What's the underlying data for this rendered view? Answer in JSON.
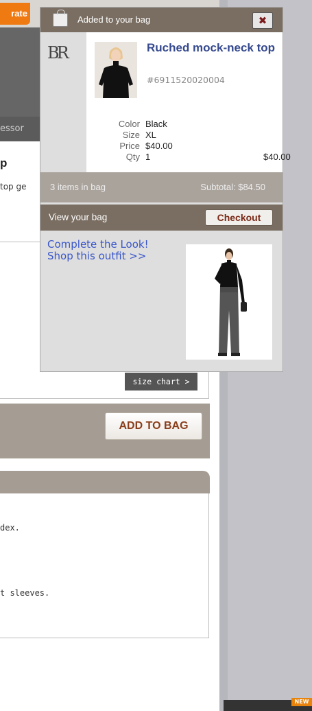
{
  "colors": {
    "accent_orange": "#f07a12",
    "popup_header": "#7a6e62",
    "link_blue": "#3a57c9",
    "product_name": "#35498e",
    "checkout_text": "#7a2a16"
  },
  "page": {
    "rate_button": "rate",
    "nav_label": "essor",
    "product_title_fragment": "p",
    "product_desc_fragment": "top ge",
    "size_chart_button": "size chart >",
    "add_to_bag_button": "ADD TO BAG",
    "details_lines": [
      "dex.",
      "t sleeves."
    ],
    "new_badge": "NEW"
  },
  "popup": {
    "bag_icon": "shopping-bag-icon",
    "title": "Added to your bag",
    "close_label": "✖",
    "logo_text": "BR",
    "item": {
      "name": "Ruched mock-neck top",
      "sku": "#6911520020004",
      "attributes": [
        {
          "label": "Color",
          "value": "Black"
        },
        {
          "label": "Size",
          "value": "XL"
        },
        {
          "label": "Price",
          "value": "$40.00"
        },
        {
          "label": "Qty",
          "value": "1"
        }
      ],
      "line_total": "$40.00"
    },
    "items_in_bag": "3 items in bag",
    "subtotal": "Subtotal: $84.50",
    "view_bag_link": "View your bag",
    "checkout_button": "Checkout",
    "complete_look_line1": "Complete the Look!",
    "complete_look_line2": "Shop this outfit >>"
  }
}
